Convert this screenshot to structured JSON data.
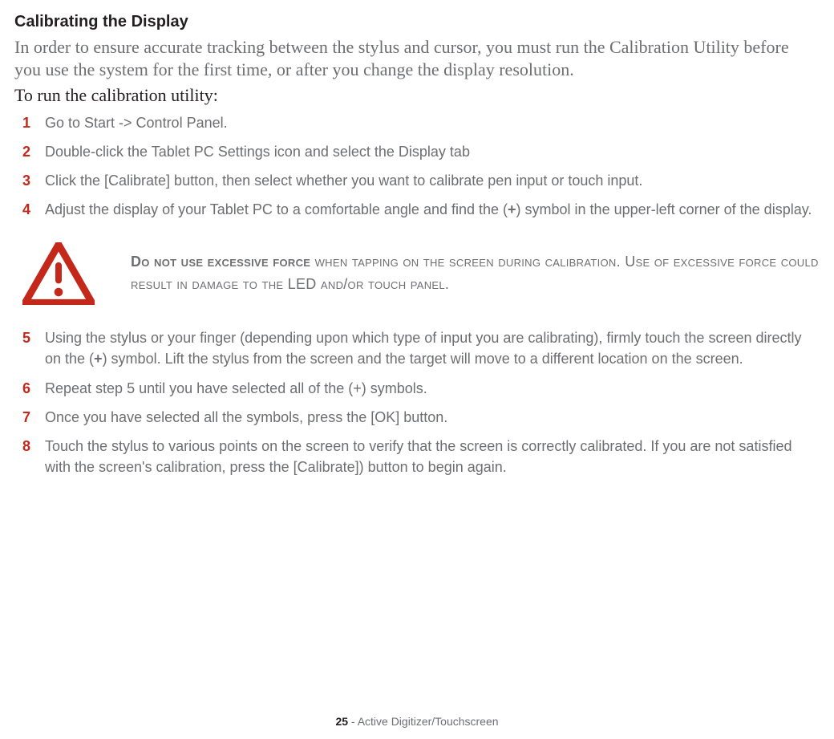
{
  "title": "Calibrating the Display",
  "intro": "In order to ensure accurate tracking between the stylus and cursor, you must run the Calibration Utility before you use the system for the first time, or after you change the display resolution.",
  "lead": "To run the calibration utility:",
  "steps": {
    "s1": {
      "num": "1",
      "text": "Go to Start -> Control Panel."
    },
    "s2": {
      "num": "2",
      "text": "Double-click the Tablet PC Settings icon and select the Display tab"
    },
    "s3": {
      "num": "3",
      "text": "Click the [Calibrate] button, then select whether you want to calibrate pen input or touch input."
    },
    "s4": {
      "num": "4",
      "pre": "Adjust the display of your Tablet PC to a comfortable angle and find the (",
      "sym": "+",
      "post": ") symbol in the upper-left corner of the display."
    },
    "s5": {
      "num": "5",
      "pre": "Using the stylus or your finger (depending upon which type of input you are calibrating), firmly touch the screen directly on the (",
      "sym": "+",
      "post": ") symbol. Lift the stylus from the screen and the target will move to a different location on the screen."
    },
    "s6": {
      "num": "6",
      "text": "Repeat step 5 until you have selected all of the (+) symbols."
    },
    "s7": {
      "num": "7",
      "text": "Once you have selected all the symbols, press the [OK] button."
    },
    "s8": {
      "num": "8",
      "text": "Touch the stylus to various points on the screen to verify that the screen is correctly calibrated. If you are not satisfied with the screen's calibration, press the [Calibrate]) button to begin again."
    }
  },
  "warning": {
    "strong": "Do not use excessive force",
    "rest": " when tapping on the screen during calibration. Use of excessive force could result in damage to the LED and/or touch panel."
  },
  "footer": {
    "page": "25",
    "sep": " - ",
    "section": "Active Digitizer/Touchscreen"
  }
}
